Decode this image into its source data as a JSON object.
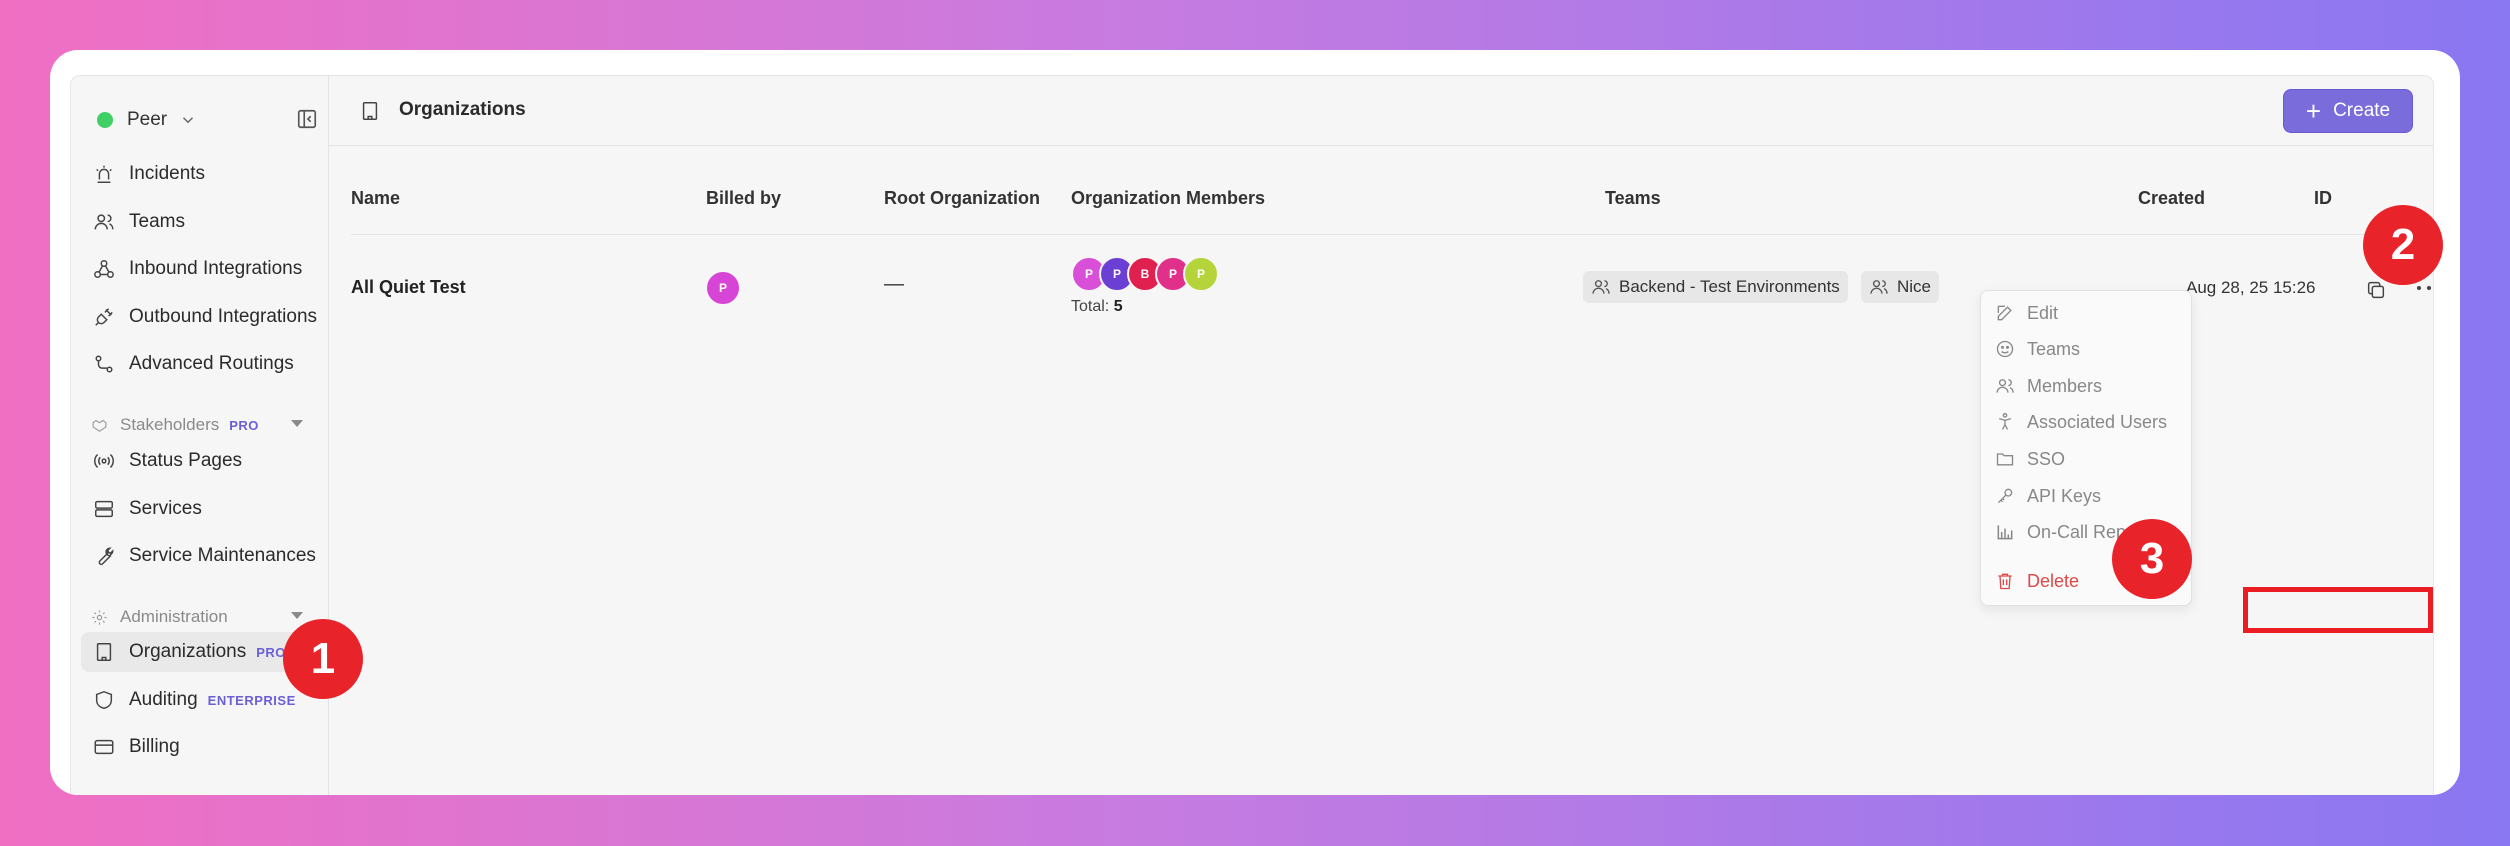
{
  "sidebar": {
    "workspace": "Peer",
    "items": [
      {
        "label": "Incidents",
        "icon": "siren-icon"
      },
      {
        "label": "Teams",
        "icon": "users-icon"
      },
      {
        "label": "Inbound Integrations",
        "icon": "webhook-icon"
      },
      {
        "label": "Outbound Integrations",
        "icon": "plug-icon"
      },
      {
        "label": "Advanced Routings",
        "icon": "route-icon"
      }
    ],
    "stakeholders": {
      "title": "Stakeholders",
      "badge": "PRO",
      "items": [
        {
          "label": "Status Pages",
          "icon": "broadcast-icon"
        },
        {
          "label": "Services",
          "icon": "server-icon"
        },
        {
          "label": "Service Maintenances",
          "icon": "wrench-icon"
        }
      ]
    },
    "administration": {
      "title": "Administration",
      "items": [
        {
          "label": "Organizations",
          "badge": "PRO",
          "icon": "building-icon"
        },
        {
          "label": "Auditing",
          "badge": "ENTERPRISE",
          "icon": "shield-icon"
        },
        {
          "label": "Billing",
          "icon": "credit-card-icon"
        }
      ]
    }
  },
  "header": {
    "title": "Organizations",
    "create_label": "Create"
  },
  "table": {
    "columns": [
      "Name",
      "Billed by",
      "Root Organization",
      "Organization Members",
      "Teams",
      "Created",
      "ID"
    ],
    "row": {
      "name": "All Quiet Test",
      "billed_by_initial": "P",
      "root_org": "—",
      "members": [
        "P",
        "P",
        "B",
        "P",
        "P"
      ],
      "member_colors": [
        "#d94fd8",
        "#6b3fd4",
        "#e0204f",
        "#e0308a",
        "#b5d43a"
      ],
      "total_label": "Total:",
      "total_value": "5",
      "teams": [
        "Backend - Test Environments",
        "Nice"
      ],
      "created": "Aug 28, 25 15:26"
    }
  },
  "menu": {
    "items": [
      "Edit",
      "Teams",
      "Members",
      "Associated Users",
      "SSO",
      "API Keys",
      "On-Call Report"
    ],
    "delete": "Delete"
  },
  "annotations": [
    "1",
    "2",
    "3"
  ],
  "colors": {
    "accent": "#7b6cdc",
    "highlight": "#ea1c24",
    "online": "#3ed063"
  }
}
